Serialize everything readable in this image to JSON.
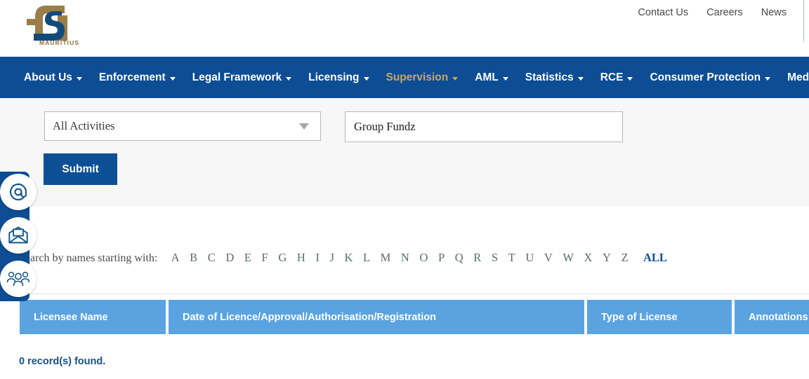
{
  "header": {
    "logo": {
      "caption": "MAURITIUS",
      "gold_color": "#8a7243",
      "navy_color": "#0c4d93"
    },
    "top_links": [
      {
        "label": "Contact Us",
        "name": "top-link-contact-us"
      },
      {
        "label": "Careers",
        "name": "top-link-careers"
      },
      {
        "label": "News",
        "name": "top-link-news"
      }
    ]
  },
  "nav": {
    "background": "#0c4d93",
    "active_color": "#c8a964",
    "items": [
      {
        "label": "About Us",
        "caret": true,
        "active": false
      },
      {
        "label": "Enforcement",
        "caret": true,
        "active": false
      },
      {
        "label": "Legal Framework",
        "caret": true,
        "active": false
      },
      {
        "label": "Licensing",
        "caret": true,
        "active": false
      },
      {
        "label": "Supervision",
        "caret": true,
        "active": true
      },
      {
        "label": "AML",
        "caret": true,
        "active": false
      },
      {
        "label": "Statistics",
        "caret": true,
        "active": false
      },
      {
        "label": "RCE",
        "caret": true,
        "active": false
      },
      {
        "label": "Consumer Protection",
        "caret": true,
        "active": false
      },
      {
        "label": "Media Corner",
        "caret": false,
        "active": false
      }
    ]
  },
  "search": {
    "activity_select": {
      "selected": "All Activities",
      "options": [
        "All Activities"
      ]
    },
    "name_input": {
      "value": "Group Fundz",
      "placeholder": ""
    },
    "submit_label": "Submit"
  },
  "side_icons": [
    {
      "name": "at-sign-icon",
      "glyph": "@"
    },
    {
      "name": "envelope-icon",
      "glyph": "envelope"
    },
    {
      "name": "people-group-icon",
      "glyph": "people"
    }
  ],
  "alphabet": {
    "label": "Search by names starting with:",
    "letters": [
      "A",
      "B",
      "C",
      "D",
      "E",
      "F",
      "G",
      "H",
      "I",
      "J",
      "K",
      "L",
      "M",
      "N",
      "O",
      "P",
      "Q",
      "R",
      "S",
      "T",
      "U",
      "V",
      "W",
      "X",
      "Y",
      "Z"
    ],
    "all_label": "ALL",
    "all_color": "#0d4f95"
  },
  "table": {
    "header_color": "#5ba3e0",
    "columns": [
      "Licensee Name",
      "Date of Licence/Approval/Authorisation/Registration",
      "Type of License",
      "Annotations"
    ],
    "rows": [],
    "record_count_text": "0 record(s) found."
  }
}
